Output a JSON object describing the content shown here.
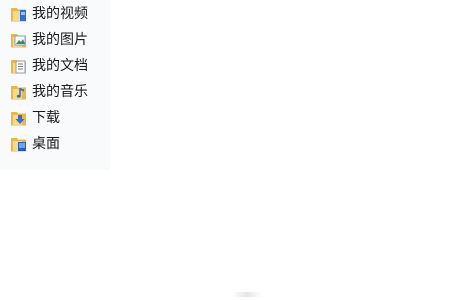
{
  "nav": {
    "items": [
      {
        "label": "我的视频",
        "icon": "videos-folder-icon"
      },
      {
        "label": "我的图片",
        "icon": "pictures-folder-icon"
      },
      {
        "label": "我的文档",
        "icon": "documents-folder-icon"
      },
      {
        "label": "我的音乐",
        "icon": "music-folder-icon"
      },
      {
        "label": "下载",
        "icon": "downloads-folder-icon"
      },
      {
        "label": "桌面",
        "icon": "desktop-folder-icon"
      }
    ]
  },
  "colors": {
    "folder": "#e8b94a",
    "folder_light": "#f7d98a",
    "accent_blue": "#2f6fd6",
    "nav_background": "#f9fafb"
  }
}
